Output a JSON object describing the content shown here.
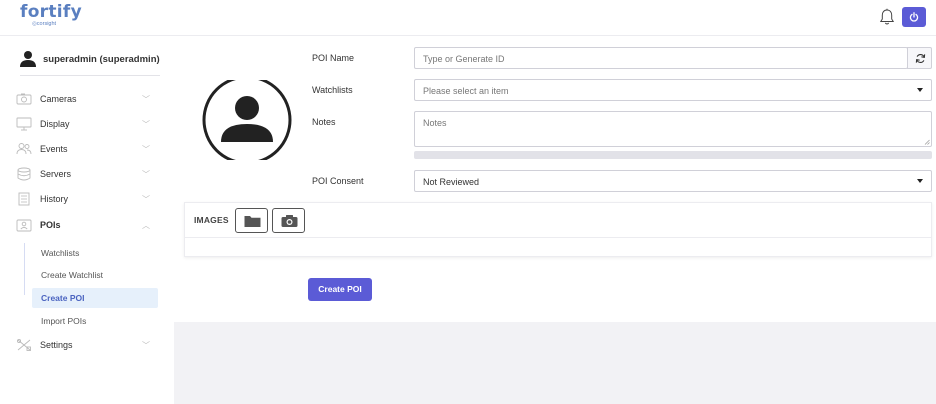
{
  "brand": {
    "name": "fortify",
    "sub": "◎corsight"
  },
  "user": {
    "name": "superadmin (superadmin)"
  },
  "sidebar": {
    "items": [
      {
        "label": "Cameras"
      },
      {
        "label": "Display"
      },
      {
        "label": "Events"
      },
      {
        "label": "Servers"
      },
      {
        "label": "History"
      },
      {
        "label": "POIs"
      },
      {
        "label": "Settings"
      }
    ],
    "poi_sub": [
      {
        "label": "Watchlists"
      },
      {
        "label": "Create Watchlist"
      },
      {
        "label": "Create POI"
      },
      {
        "label": "Import POIs"
      }
    ]
  },
  "form": {
    "poi_name": {
      "label": "POI Name",
      "placeholder": "Type or Generate ID"
    },
    "watchlists": {
      "label": "Watchlists",
      "placeholder": "Please select an item"
    },
    "notes": {
      "label": "Notes",
      "placeholder": "Notes"
    },
    "consent": {
      "label": "POI Consent",
      "value": "Not Reviewed"
    }
  },
  "images": {
    "title": "IMAGES"
  },
  "actions": {
    "create": "Create POI"
  },
  "colors": {
    "accent": "#5b5bd6",
    "brand": "#5a7fc0",
    "active_bg": "#e6f0fb"
  }
}
